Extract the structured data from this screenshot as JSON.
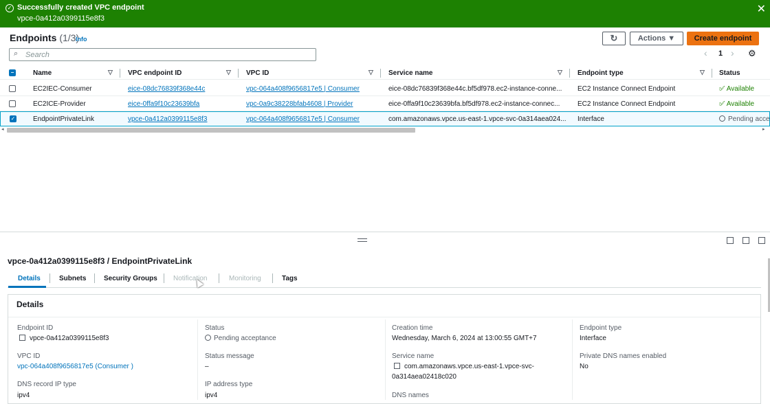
{
  "banner": {
    "title": "Successfully created VPC endpoint",
    "subtitle": "vpce-0a412a0399115e8f3",
    "close": "✕"
  },
  "header": {
    "title": "Endpoints",
    "count": "(1/3)",
    "info": "Info",
    "refresh_icon": "↻",
    "actions_label": "Actions ▼",
    "create_label": "Create endpoint"
  },
  "search": {
    "placeholder": "Search",
    "icon": "🔍"
  },
  "pager": {
    "prev": "‹",
    "page": "1",
    "next": "›",
    "settings": "⚙"
  },
  "table": {
    "columns": [
      "Name",
      "VPC endpoint ID",
      "VPC ID",
      "Service name",
      "Endpoint type",
      "Status"
    ],
    "rows": [
      {
        "name": "EC2IEC-Consumer",
        "endpoint_id": "eice-08dc76839f368e44c",
        "vpc_id": "vpc-064a408f9656817e5 | Consumer",
        "service": "eice-08dc76839f368e44c.bf5df978.ec2-instance-conne...",
        "type": "EC2 Instance Connect Endpoint",
        "status": "Available",
        "selected": false
      },
      {
        "name": "EC2ICE-Provider",
        "endpoint_id": "eice-0ffa9f10c23639bfa",
        "vpc_id": "vpc-0a9c38228bfab4608 | Provider",
        "service": "eice-0ffa9f10c23639bfa.bf5df978.ec2-instance-connec...",
        "type": "EC2 Instance Connect Endpoint",
        "status": "Available",
        "selected": false
      },
      {
        "name": "EndpointPrivateLink",
        "endpoint_id": "vpce-0a412a0399115e8f3",
        "vpc_id": "vpc-064a408f9656817e5 | Consumer",
        "service": "com.amazonaws.vpce.us-east-1.vpce-svc-0a314aea024...",
        "type": "Interface",
        "status": "Pending acce",
        "selected": true
      }
    ]
  },
  "detail": {
    "title": "vpce-0a412a0399115e8f3 / EndpointPrivateLink",
    "tabs": [
      "Details",
      "Subnets",
      "Security Groups",
      "Notification",
      "Monitoring",
      "Tags"
    ],
    "panel_title": "Details",
    "fields": {
      "endpoint_id_label": "Endpoint ID",
      "endpoint_id": "vpce-0a412a0399115e8f3",
      "status_label": "Status",
      "status": "Pending acceptance",
      "creation_label": "Creation time",
      "creation": "Wednesday, March 6, 2024 at 13:00:55 GMT+7",
      "type_label": "Endpoint type",
      "type": "Interface",
      "vpc_label": "VPC ID",
      "vpc": "vpc-064a408f9656817e5 (Consumer )",
      "status_msg_label": "Status message",
      "status_msg": "–",
      "service_label": "Service name",
      "service_line1": "com.amazonaws.vpce.us-east-1.vpce-svc-",
      "service_line2": "0a314aea02418c020",
      "dns_enabled_label": "Private DNS names enabled",
      "dns_enabled": "No",
      "dns_ip_label": "DNS record IP type",
      "dns_ip": "ipv4",
      "ip_type_label": "IP address type",
      "ip_type": "ipv4",
      "dns_names_label": "DNS names"
    }
  }
}
